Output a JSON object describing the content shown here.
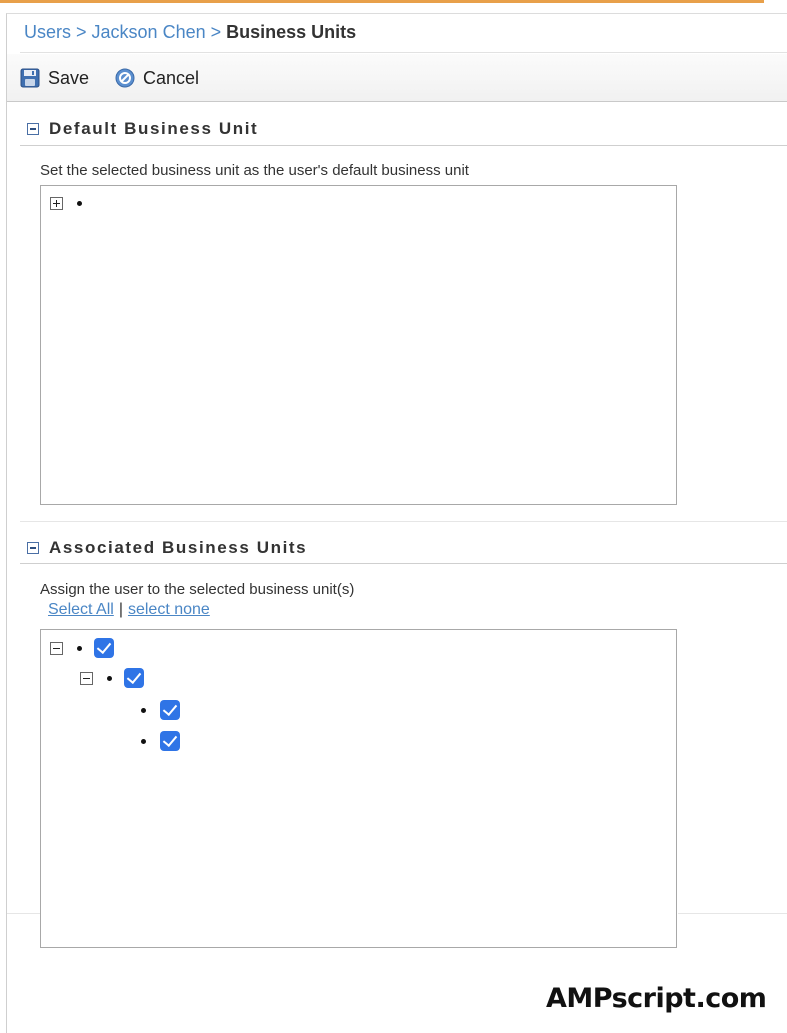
{
  "breadcrumb": {
    "items": [
      {
        "label": "Users"
      },
      {
        "label": "Jackson Chen"
      }
    ],
    "separator": ">",
    "current": "Business Units"
  },
  "toolbar": {
    "save_label": "Save",
    "cancel_label": "Cancel",
    "save_icon": "floppy-disk-icon",
    "cancel_icon": "cancel-circle-icon"
  },
  "default_section": {
    "title": "Default Business Unit",
    "description": "Set the selected business unit as the user's default business unit",
    "tree": [
      {
        "label": "",
        "toggle": "plus",
        "level": 0
      }
    ]
  },
  "associated_section": {
    "title": "Associated Business Units",
    "description": "Assign the user to the selected business unit(s)",
    "select_all_label": "Select All",
    "divider": "|",
    "select_none_label": "select none",
    "tree": [
      {
        "label": "",
        "toggle": "minus",
        "checked": true,
        "level": 0
      },
      {
        "label": "",
        "toggle": "minus",
        "checked": true,
        "level": 1
      },
      {
        "label": "",
        "checked": true,
        "level": 2
      },
      {
        "label": "",
        "checked": true,
        "level": 2
      }
    ]
  },
  "watermark": "AMPscript.com",
  "colors": {
    "link": "#4a86c5",
    "checkbox": "#2f74e6",
    "accent_top": "#e8a04a"
  }
}
